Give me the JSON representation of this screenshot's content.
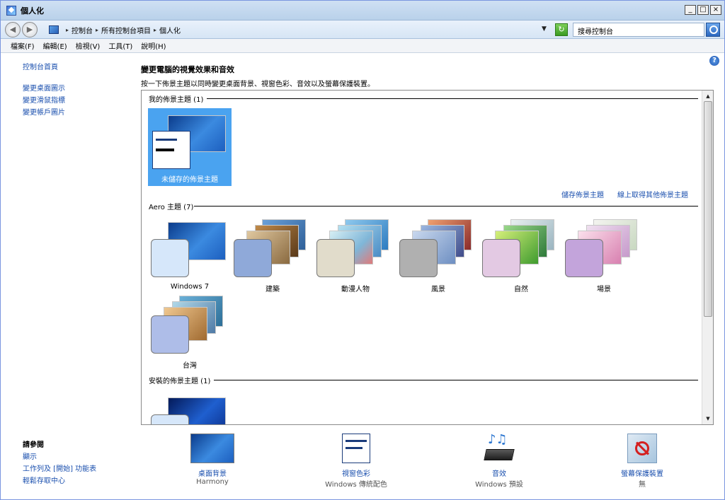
{
  "window": {
    "title": "個人化",
    "buttons": [
      "_",
      "□",
      "×"
    ]
  },
  "address": {
    "crumbs": [
      "控制台",
      "所有控制台項目",
      "個人化"
    ],
    "search_placeholder": "搜尋控制台"
  },
  "menu": [
    "檔案(F)",
    "編輯(E)",
    "檢視(V)",
    "工具(T)",
    "說明(H)"
  ],
  "left": {
    "home": "控制台首頁",
    "links": [
      "變更桌面圖示",
      "變更滑鼠指標",
      "變更帳戶圖片"
    ],
    "see_also_title": "請參閱",
    "see_also": [
      "顯示",
      "工作列及 [開始] 功能表",
      "輕鬆存取中心"
    ]
  },
  "main": {
    "title": "變更電腦的視覺效果和音效",
    "subtitle": "按一下佈景主題以同時變更桌面背景、視窗色彩、音效以及螢幕保護裝置。",
    "my_themes_header": "我的佈景主題 (1)",
    "my_themes": [
      {
        "label": "未儲存的佈景主題",
        "selected": true
      }
    ],
    "save_theme": "儲存佈景主題",
    "get_more": "線上取得其他佈景主題",
    "aero_header": "Aero 主題 (7)",
    "aero_themes": [
      {
        "label": "Windows 7",
        "swatch": "#d6e7fa",
        "bg": "#1f6fd0"
      },
      {
        "label": "建築",
        "swatch": "#8fa9d9",
        "bg": "#c08a4a"
      },
      {
        "label": "動漫人物",
        "swatch": "#e1dccb",
        "bg": "#7fb6d8"
      },
      {
        "label": "風景",
        "swatch": "#b0b0b0",
        "bg": "#6e8fc2"
      },
      {
        "label": "自然",
        "swatch": "#e3c9e3",
        "bg": "#2f9b54"
      },
      {
        "label": "場景",
        "swatch": "#c3a4db",
        "bg": "#c69acb"
      },
      {
        "label": "台灣",
        "swatch": "#aebde8",
        "bg": "#4f7aa6"
      }
    ],
    "installed_header": "安裝的佈景主題 (1)"
  },
  "bottom": [
    {
      "label": "桌面背景",
      "sub": "Harmony",
      "icon": "desktop-background-icon"
    },
    {
      "label": "視窗色彩",
      "sub": "Windows 傳統配色",
      "icon": "window-color-icon"
    },
    {
      "label": "音效",
      "sub": "Windows 預設",
      "icon": "sounds-icon"
    },
    {
      "label": "螢幕保護裝置",
      "sub": "無",
      "icon": "screen-saver-icon"
    }
  ],
  "colors": {
    "link": "#1a4fae",
    "selected": "#4aa3f0"
  }
}
